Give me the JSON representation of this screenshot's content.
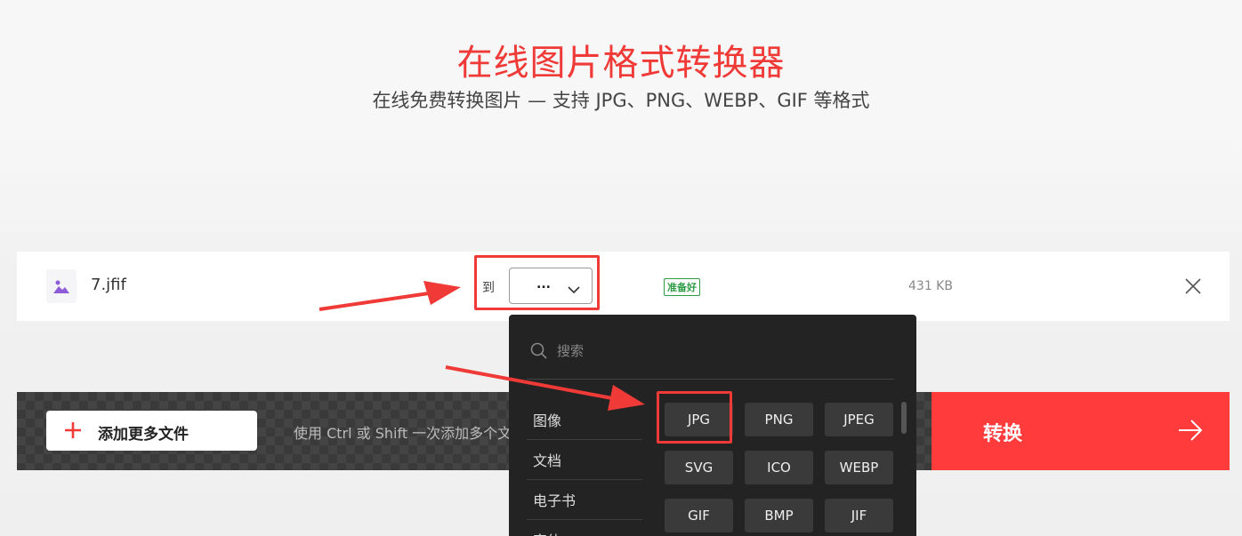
{
  "header": {
    "title": "在线图片格式转换器",
    "subtitle": "在线免费转换图片 — 支持 JPG、PNG、WEBP、GIF 等格式"
  },
  "file_row": {
    "file_icon": "image-icon",
    "file_name": "7.jfif",
    "to_label": "到",
    "selected_format": "...",
    "status": "准备好",
    "size": "431 KB",
    "remove_icon": "close-icon"
  },
  "action_bar": {
    "add_files_label": "添加更多文件",
    "hint": "使用 Ctrl 或 Shift 一次添加多个文",
    "convert_label": "转换"
  },
  "dropdown": {
    "search_placeholder": "搜索",
    "categories": [
      "图像",
      "文档",
      "电子书",
      "字体"
    ],
    "formats": [
      "JPG",
      "PNG",
      "JPEG",
      "SVG",
      "ICO",
      "WEBP",
      "GIF",
      "BMP",
      "JIF"
    ]
  },
  "colors": {
    "brand": "#ef3a37",
    "convert": "#ff3b3b",
    "ready": "#2e9c45",
    "dropdown_bg": "#232323"
  }
}
